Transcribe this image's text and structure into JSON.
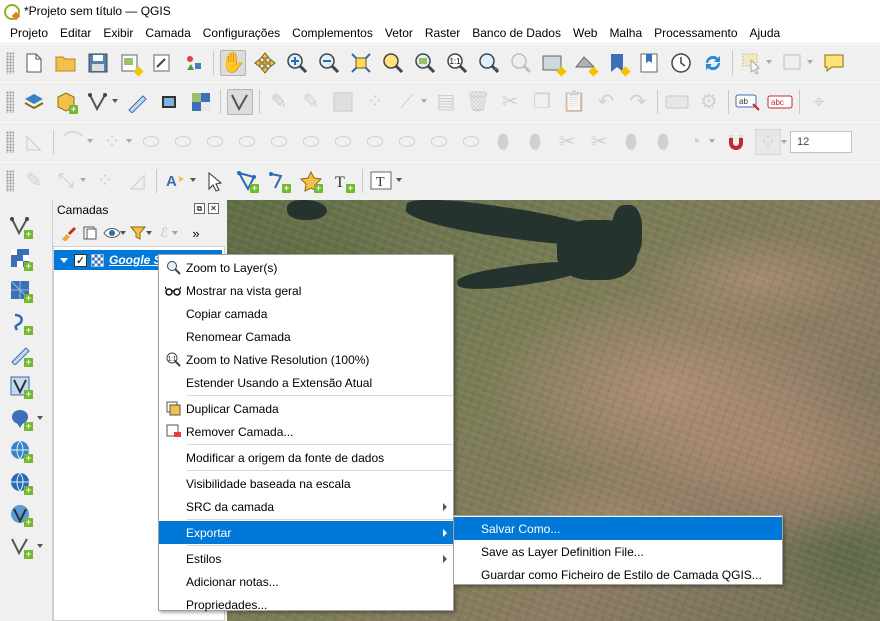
{
  "window": {
    "title": "*Projeto sem título — QGIS"
  },
  "menubar": {
    "items": [
      "Projeto",
      "Editar",
      "Exibir",
      "Camada",
      "Configurações",
      "Complementos",
      "Vetor",
      "Raster",
      "Banco de Dados",
      "Web",
      "Malha",
      "Processamento",
      "Ajuda"
    ]
  },
  "toolbar": {
    "snapping_tolerance": "12"
  },
  "layers_panel": {
    "title": "Camadas",
    "layer_name": "Google Satellite",
    "layer_checked": "✓"
  },
  "context_menu": {
    "items": [
      {
        "label": "Zoom to Layer(s)",
        "icon": "zoom-layer-icon"
      },
      {
        "label": "Mostrar na vista geral",
        "icon": "overview-icon"
      },
      {
        "label": "Copiar camada",
        "icon": ""
      },
      {
        "label": "Renomear Camada",
        "icon": ""
      },
      {
        "label": "Zoom to Native Resolution (100%)",
        "icon": "zoom-native-icon"
      },
      {
        "label": "Estender Usando a Extensão Atual",
        "icon": ""
      },
      {
        "label": "Duplicar Camada",
        "icon": "duplicate-layer-icon"
      },
      {
        "label": "Remover Camada...",
        "icon": "remove-layer-icon"
      },
      {
        "label": "Modificar a origem da fonte de dados",
        "icon": ""
      },
      {
        "label": "Visibilidade baseada na escala",
        "icon": ""
      },
      {
        "label": "SRC da camada",
        "icon": ""
      },
      {
        "label": "Exportar",
        "icon": ""
      },
      {
        "label": "Estilos",
        "icon": ""
      },
      {
        "label": "Adicionar notas...",
        "icon": ""
      },
      {
        "label": "Propriedades...",
        "icon": ""
      }
    ]
  },
  "export_submenu": {
    "items": [
      "Salvar Como...",
      "Save as Layer Definition File...",
      "Guardar como Ficheiro de Estilo de Camada QGIS..."
    ]
  },
  "colors": {
    "selection": "#0078d7",
    "qgis_green": "#93b023",
    "qgis_orange": "#ee7913"
  }
}
